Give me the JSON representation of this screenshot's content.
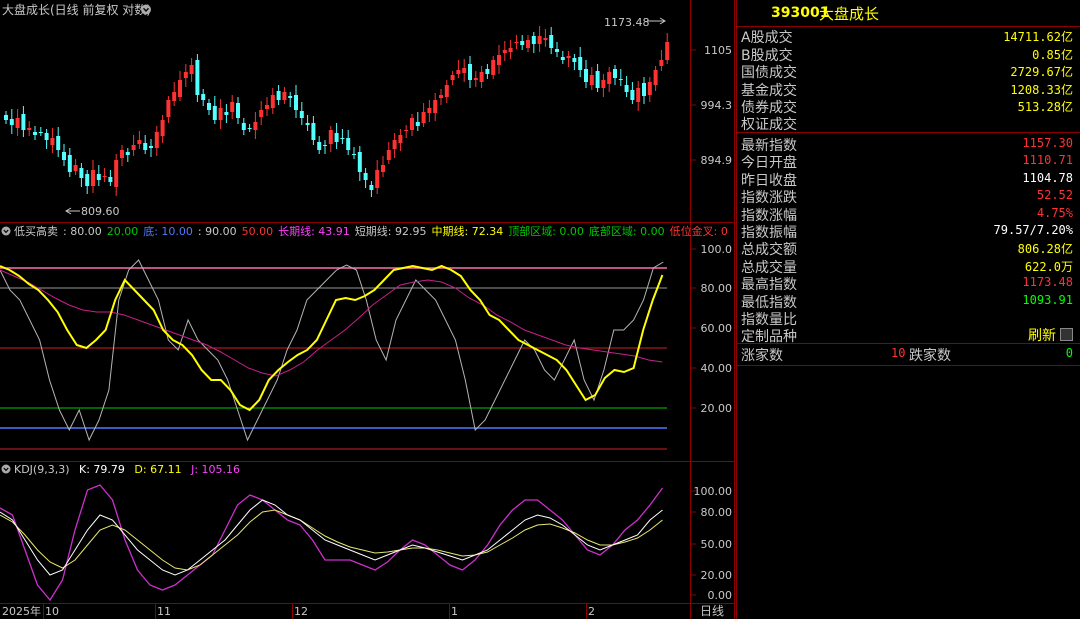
{
  "main_chart": {
    "title": "大盘成长(日线 前复权 对数)",
    "price_ticks": [
      "1105",
      "994.3",
      "894.9"
    ],
    "high_marker": "1173.48",
    "low_marker": "809.60"
  },
  "lowbuy": {
    "label": "低买高卖",
    "params": [
      {
        "text": ": 80.00",
        "color": "#c8c8c8"
      },
      {
        "text": "20.00",
        "color": "#00c800"
      },
      {
        "text": "底: 10.00",
        "color": "#5078ff"
      },
      {
        "text": ": 90.00",
        "color": "#c8c8c8"
      },
      {
        "text": "50.00",
        "color": "#ff3232"
      },
      {
        "text": "长期线: 43.91",
        "color": "#ff40ff"
      },
      {
        "text": "短期线: 92.95",
        "color": "#c8c8c8"
      },
      {
        "text": "中期线: 72.34",
        "color": "#ffff00"
      },
      {
        "text": "顶部区域: 0.00",
        "color": "#00c800"
      },
      {
        "text": "底部区域: 0.00",
        "color": "#00c800"
      },
      {
        "text": "低位金叉: 0",
        "color": "#ff3232"
      }
    ],
    "ticks": [
      "100.0",
      "80.00",
      "60.00",
      "40.00",
      "20.00"
    ]
  },
  "kdj": {
    "label": "KDJ(9,3,3)",
    "k": "K: 79.79",
    "d": "D: 67.11",
    "j": "J: 105.16",
    "ticks": [
      "100.00",
      "80.00",
      "50.00",
      "20.00",
      "0.00"
    ]
  },
  "date_axis": {
    "labels": [
      "2025年",
      "10",
      "11",
      "12",
      "1",
      "2"
    ],
    "period": "日线"
  },
  "right_panel": {
    "code": "393001",
    "name": "大盘成长",
    "rows": [
      {
        "label": "A股成交",
        "value": "14711.62亿",
        "color": "#ffff00"
      },
      {
        "label": "B股成交",
        "value": "0.85亿",
        "color": "#ffff00"
      },
      {
        "label": "国债成交",
        "value": "2729.67亿",
        "color": "#ffff00"
      },
      {
        "label": "基金成交",
        "value": "1208.33亿",
        "color": "#ffff00"
      },
      {
        "label": "债券成交",
        "value": "513.28亿",
        "color": "#ffff00"
      },
      {
        "label": "权证成交",
        "value": "",
        "color": "#ffff00"
      },
      {
        "label": "最新指数",
        "value": "1157.30",
        "color": "#ff3232"
      },
      {
        "label": "今日开盘",
        "value": "1110.71",
        "color": "#ff3232"
      },
      {
        "label": "昨日收盘",
        "value": "1104.78",
        "color": "#ffffff"
      },
      {
        "label": "指数涨跌",
        "value": "52.52",
        "color": "#ff3232"
      },
      {
        "label": "指数涨幅",
        "value": "4.75%",
        "color": "#ff3232"
      },
      {
        "label": "指数振幅",
        "value": "79.57/7.20%",
        "color": "#ffffff"
      },
      {
        "label": "总成交额",
        "value": "806.28亿",
        "color": "#ffff00"
      },
      {
        "label": "总成交量",
        "value": "622.0万",
        "color": "#ffff00"
      },
      {
        "label": "最高指数",
        "value": "1173.48",
        "color": "#ff3232"
      },
      {
        "label": "最低指数",
        "value": "1093.91",
        "color": "#00ff00"
      },
      {
        "label": "指数量比",
        "value": "",
        "color": "#ffffff"
      },
      {
        "label": "定制品种",
        "value": "",
        "color": "#ffffff"
      }
    ],
    "refresh_label": "刷新",
    "up_label": "涨家数",
    "up_value": "10",
    "down_label": "跌家数",
    "down_value": "0"
  },
  "colors": {
    "up": "#ff3232",
    "down": "#54ffff",
    "border": "#8b0000",
    "yellow": "#ffff00",
    "magenta": "#ff40ff"
  }
}
